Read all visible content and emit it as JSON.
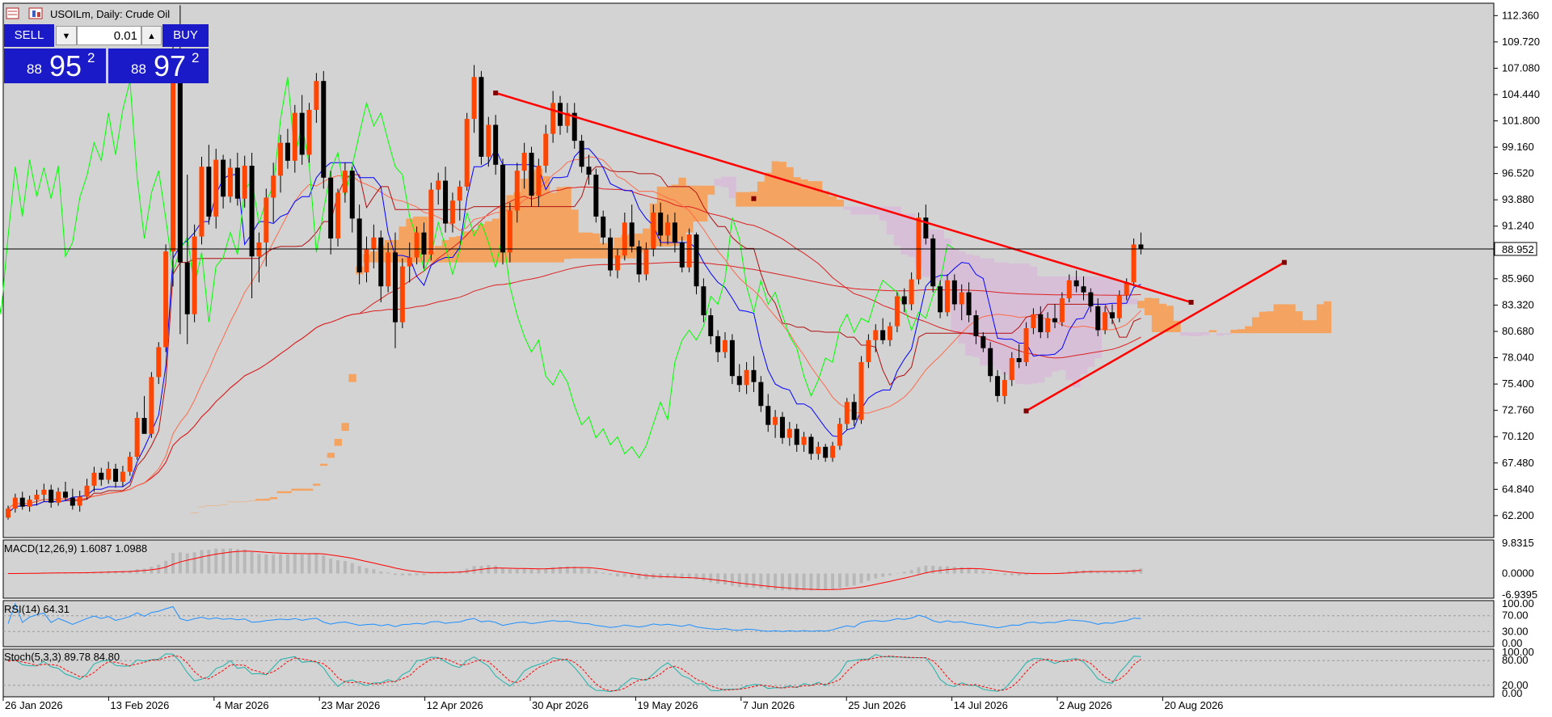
{
  "header": {
    "symbol_title": "USOILm, Daily:  Crude Oil"
  },
  "trade_panel": {
    "sell_label": "SELL",
    "buy_label": "BUY",
    "lot_value": "0.01",
    "bid": {
      "small": "88",
      "big": "95",
      "sup": "2"
    },
    "ask": {
      "small": "88",
      "big": "97",
      "sup": "2"
    }
  },
  "indicators": {
    "macd_label": "MACD(12,26,9) 1.6087 1.0988",
    "rsi_label": "RSI(14) 64.31",
    "stoch_label": "Stoch(5,3,3) 89.78 84.80"
  },
  "colors": {
    "bull_candle": "#ff4500",
    "bear_candle": "#000000",
    "cloud_bull": "#f4a460",
    "cloud_bear": "#d8bfd8",
    "trendline": "#ff0000",
    "tenkan": "#0000ff",
    "chikou": "#00ff00",
    "rsi": "#1e90ff",
    "stoch_main": "#20b2aa",
    "stoch_signal": "#ff0000"
  },
  "chart_data": {
    "type": "candlestick",
    "timeframe": "Daily",
    "current_price": "88.952",
    "price_ticks": [
      "112.360",
      "109.720",
      "107.080",
      "104.440",
      "101.800",
      "99.160",
      "96.520",
      "93.880",
      "91.240",
      "85.960",
      "83.320",
      "80.680",
      "78.040",
      "75.400",
      "72.760",
      "70.120",
      "67.480",
      "64.840",
      "62.200"
    ],
    "ylim": [
      60.0,
      113.6
    ],
    "date_ticks": [
      "26 Jan 2026",
      "13 Feb 2026",
      "4 Mar 2026",
      "23 Mar 2026",
      "12 Apr 2026",
      "30 Apr 2026",
      "19 May 2026",
      "7 Jun 2026",
      "25 Jun 2026",
      "14 Jul 2026",
      "2 Aug 2026",
      "20 Aug 2026"
    ],
    "candles": [
      [
        62.0,
        63.2,
        61.8,
        62.9
      ],
      [
        62.9,
        64.4,
        62.5,
        64.0
      ],
      [
        64.0,
        64.6,
        62.8,
        63.1
      ],
      [
        63.1,
        64.2,
        62.6,
        63.8
      ],
      [
        63.8,
        64.8,
        63.2,
        64.3
      ],
      [
        64.3,
        65.4,
        63.6,
        64.8
      ],
      [
        64.8,
        65.3,
        63.0,
        63.5
      ],
      [
        63.5,
        65.0,
        63.2,
        64.6
      ],
      [
        64.6,
        65.6,
        63.7,
        64.0
      ],
      [
        64.0,
        64.9,
        62.8,
        63.2
      ],
      [
        63.2,
        64.7,
        62.6,
        64.1
      ],
      [
        64.1,
        65.9,
        63.8,
        65.2
      ],
      [
        65.2,
        67.1,
        64.6,
        66.5
      ],
      [
        66.5,
        67.0,
        65.2,
        65.8
      ],
      [
        65.8,
        67.6,
        65.4,
        66.9
      ],
      [
        66.9,
        67.4,
        65.0,
        65.6
      ],
      [
        65.6,
        67.2,
        65.1,
        66.6
      ],
      [
        66.6,
        68.6,
        66.2,
        68.1
      ],
      [
        68.1,
        72.6,
        67.8,
        72.0
      ],
      [
        72.0,
        74.2,
        71.2,
        70.4
      ],
      [
        70.4,
        76.6,
        70.0,
        76.1
      ],
      [
        76.1,
        79.6,
        75.4,
        79.1
      ],
      [
        79.1,
        89.4,
        78.6,
        88.7
      ],
      [
        88.7,
        111.0,
        85.2,
        108.4
      ],
      [
        108.4,
        113.4,
        80.4,
        87.6
      ],
      [
        87.6,
        96.4,
        79.4,
        82.4
      ],
      [
        82.4,
        91.4,
        81.6,
        90.2
      ],
      [
        90.2,
        98.2,
        89.4,
        97.2
      ],
      [
        97.2,
        99.4,
        91.4,
        92.2
      ],
      [
        92.2,
        99.0,
        91.0,
        97.9
      ],
      [
        97.9,
        98.4,
        93.0,
        94.2
      ],
      [
        94.2,
        98.0,
        93.6,
        97.1
      ],
      [
        97.1,
        98.6,
        93.3,
        94.0
      ],
      [
        94.0,
        98.3,
        93.1,
        97.3
      ],
      [
        97.3,
        98.6,
        84.0,
        88.2
      ],
      [
        88.2,
        90.6,
        85.6,
        89.6
      ],
      [
        89.6,
        95.0,
        87.2,
        94.1
      ],
      [
        94.1,
        97.6,
        91.6,
        96.3
      ],
      [
        96.3,
        100.4,
        94.6,
        99.6
      ],
      [
        99.6,
        101.0,
        97.0,
        97.8
      ],
      [
        97.8,
        103.4,
        96.6,
        102.6
      ],
      [
        102.6,
        104.4,
        97.4,
        98.4
      ],
      [
        98.4,
        103.6,
        97.6,
        102.9
      ],
      [
        102.9,
        106.6,
        101.6,
        105.8
      ],
      [
        105.8,
        106.8,
        95.0,
        96.1
      ],
      [
        96.1,
        96.8,
        88.4,
        90.0
      ],
      [
        90.0,
        95.0,
        89.2,
        94.6
      ],
      [
        94.6,
        97.6,
        93.6,
        96.8
      ],
      [
        96.8,
        97.2,
        90.6,
        92.0
      ],
      [
        92.0,
        93.4,
        85.4,
        86.6
      ],
      [
        86.6,
        90.2,
        85.6,
        88.9
      ],
      [
        88.9,
        91.4,
        87.0,
        90.1
      ],
      [
        90.1,
        90.8,
        83.6,
        85.2
      ],
      [
        85.2,
        89.6,
        84.6,
        88.6
      ],
      [
        88.6,
        90.6,
        79.0,
        81.6
      ],
      [
        81.6,
        88.0,
        81.0,
        87.2
      ],
      [
        87.2,
        89.6,
        85.6,
        88.1
      ],
      [
        88.1,
        91.2,
        87.4,
        90.6
      ],
      [
        90.6,
        91.6,
        87.0,
        88.4
      ],
      [
        88.4,
        95.6,
        87.8,
        94.9
      ],
      [
        94.9,
        96.6,
        93.4,
        95.8
      ],
      [
        95.8,
        97.2,
        90.6,
        91.5
      ],
      [
        91.5,
        94.6,
        90.6,
        93.8
      ],
      [
        93.8,
        95.8,
        91.8,
        95.2
      ],
      [
        95.2,
        102.6,
        94.8,
        102.0
      ],
      [
        102.0,
        107.4,
        100.6,
        106.2
      ],
      [
        106.2,
        106.8,
        97.4,
        98.2
      ],
      [
        98.2,
        102.2,
        97.2,
        101.4
      ],
      [
        101.4,
        102.4,
        96.4,
        97.4
      ],
      [
        97.4,
        98.0,
        87.4,
        88.6
      ],
      [
        88.6,
        93.6,
        87.6,
        92.8
      ],
      [
        92.8,
        97.6,
        91.6,
        96.8
      ],
      [
        96.8,
        99.6,
        95.0,
        98.6
      ],
      [
        98.6,
        99.2,
        93.2,
        94.3
      ],
      [
        94.3,
        98.0,
        93.2,
        97.3
      ],
      [
        97.3,
        101.4,
        96.6,
        100.5
      ],
      [
        100.5,
        104.8,
        99.6,
        103.6
      ],
      [
        103.6,
        104.3,
        100.4,
        101.3
      ],
      [
        101.3,
        103.6,
        100.6,
        102.6
      ],
      [
        102.6,
        103.6,
        99.0,
        99.8
      ],
      [
        99.8,
        100.4,
        96.6,
        97.2
      ],
      [
        97.2,
        98.4,
        95.4,
        96.4
      ],
      [
        96.4,
        97.0,
        91.6,
        92.2
      ],
      [
        92.2,
        92.8,
        89.4,
        90.1
      ],
      [
        90.1,
        91.0,
        86.2,
        86.8
      ],
      [
        86.8,
        89.0,
        86.0,
        88.3
      ],
      [
        88.3,
        92.6,
        87.8,
        91.6
      ],
      [
        91.6,
        93.4,
        88.6,
        89.2
      ],
      [
        89.2,
        89.8,
        85.6,
        86.4
      ],
      [
        86.4,
        89.6,
        85.8,
        88.9
      ],
      [
        88.9,
        93.4,
        88.2,
        92.6
      ],
      [
        92.6,
        93.6,
        89.2,
        90.3
      ],
      [
        90.3,
        92.4,
        89.4,
        91.6
      ],
      [
        91.6,
        92.6,
        88.6,
        89.6
      ],
      [
        89.6,
        90.2,
        86.6,
        87.1
      ],
      [
        87.1,
        91.0,
        86.6,
        90.4
      ],
      [
        90.4,
        90.6,
        84.4,
        85.2
      ],
      [
        85.2,
        86.0,
        81.6,
        82.3
      ],
      [
        82.3,
        83.0,
        79.4,
        80.2
      ],
      [
        80.2,
        80.8,
        77.6,
        78.6
      ],
      [
        78.6,
        80.6,
        78.0,
        79.8
      ],
      [
        79.8,
        80.4,
        75.4,
        76.2
      ],
      [
        76.2,
        77.4,
        74.6,
        75.3
      ],
      [
        75.3,
        77.6,
        74.4,
        76.8
      ],
      [
        76.8,
        78.2,
        74.6,
        75.6
      ],
      [
        75.6,
        76.2,
        72.6,
        73.2
      ],
      [
        73.2,
        74.4,
        70.6,
        71.3
      ],
      [
        71.3,
        72.8,
        70.0,
        72.1
      ],
      [
        72.1,
        72.6,
        69.4,
        70.0
      ],
      [
        70.0,
        71.6,
        69.2,
        70.9
      ],
      [
        70.9,
        71.4,
        68.6,
        69.3
      ],
      [
        69.3,
        70.6,
        68.6,
        70.1
      ],
      [
        70.1,
        70.4,
        67.8,
        68.4
      ],
      [
        68.4,
        69.6,
        67.8,
        69.1
      ],
      [
        69.1,
        69.4,
        67.6,
        68.0
      ],
      [
        68.0,
        69.6,
        67.6,
        69.2
      ],
      [
        69.2,
        72.0,
        68.8,
        71.4
      ],
      [
        71.4,
        74.0,
        70.8,
        73.6
      ],
      [
        73.6,
        74.4,
        71.2,
        71.8
      ],
      [
        71.8,
        78.2,
        71.4,
        77.6
      ],
      [
        77.6,
        80.4,
        77.0,
        79.8
      ],
      [
        79.8,
        81.4,
        78.6,
        80.8
      ],
      [
        80.8,
        82.0,
        79.4,
        79.8
      ],
      [
        79.8,
        81.6,
        79.2,
        81.2
      ],
      [
        81.2,
        84.6,
        80.6,
        84.2
      ],
      [
        84.2,
        85.0,
        82.6,
        83.4
      ],
      [
        83.4,
        86.6,
        82.8,
        85.9
      ],
      [
        85.9,
        92.6,
        85.4,
        92.1
      ],
      [
        92.1,
        93.4,
        89.4,
        90.0
      ],
      [
        90.0,
        90.4,
        84.6,
        85.2
      ],
      [
        85.2,
        85.8,
        82.0,
        82.6
      ],
      [
        82.6,
        86.4,
        82.2,
        85.8
      ],
      [
        85.8,
        86.4,
        82.8,
        83.4
      ],
      [
        83.4,
        85.4,
        81.8,
        84.6
      ],
      [
        84.6,
        85.6,
        81.6,
        82.3
      ],
      [
        82.3,
        82.8,
        79.4,
        80.2
      ],
      [
        80.2,
        80.6,
        78.6,
        79.0
      ],
      [
        79.0,
        79.6,
        75.6,
        76.2
      ],
      [
        76.2,
        76.8,
        73.6,
        74.2
      ],
      [
        74.2,
        76.6,
        73.4,
        75.8
      ],
      [
        75.8,
        78.6,
        75.2,
        78.0
      ],
      [
        78.0,
        79.4,
        77.0,
        77.6
      ],
      [
        77.6,
        81.6,
        77.2,
        81.0
      ],
      [
        81.0,
        83.0,
        80.4,
        82.4
      ],
      [
        82.4,
        83.2,
        80.0,
        80.6
      ],
      [
        80.6,
        82.6,
        80.0,
        82.0
      ],
      [
        82.0,
        83.4,
        81.0,
        81.6
      ],
      [
        81.6,
        84.6,
        81.2,
        84.0
      ],
      [
        84.0,
        86.4,
        83.6,
        85.8
      ],
      [
        85.8,
        86.8,
        84.6,
        85.2
      ],
      [
        85.2,
        86.2,
        83.8,
        84.6
      ],
      [
        84.6,
        85.0,
        82.6,
        83.2
      ],
      [
        83.2,
        84.0,
        80.2,
        80.8
      ],
      [
        80.8,
        83.2,
        80.4,
        82.6
      ],
      [
        82.6,
        83.4,
        81.4,
        82.0
      ],
      [
        82.0,
        84.8,
        81.6,
        84.3
      ],
      [
        84.3,
        86.0,
        83.8,
        85.6
      ],
      [
        85.6,
        90.0,
        85.2,
        89.4
      ],
      [
        89.4,
        90.6,
        88.4,
        88.95
      ]
    ],
    "macd": {
      "label_max": "9.8315",
      "label_zero": "0.0000",
      "label_min": "-6.9395",
      "ylim": [
        -6.9395,
        9.8315
      ]
    },
    "rsi": {
      "ticks": [
        "100.00",
        "70.00",
        "30.00",
        "0.00"
      ],
      "ylim": [
        0,
        100
      ]
    },
    "stoch": {
      "ticks": [
        "100.00",
        "80.00",
        "20.00",
        "0.00"
      ],
      "ylim": [
        0,
        100
      ]
    }
  }
}
